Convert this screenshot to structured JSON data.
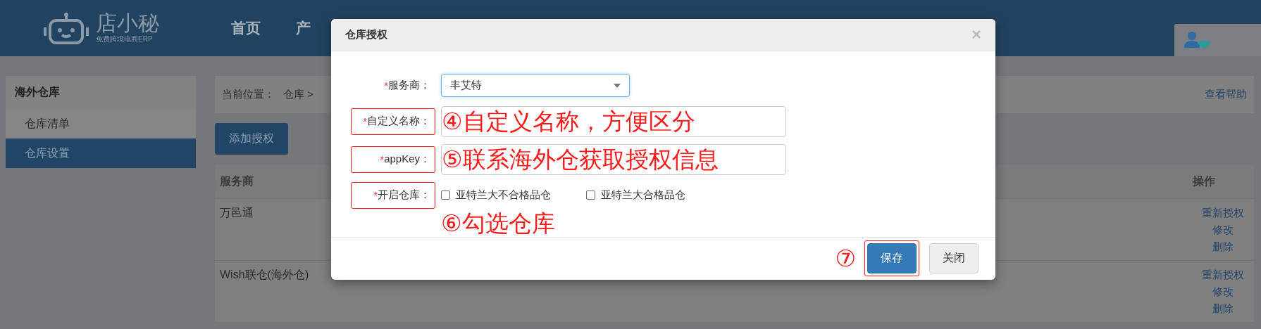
{
  "header": {
    "logo": {
      "name": "店小秘",
      "tagline": "免费跨境电商ERP"
    },
    "nav": [
      {
        "label": "首页"
      },
      {
        "label": "产"
      }
    ]
  },
  "sidebar": {
    "title": "海外仓库",
    "items": [
      {
        "label": "仓库清单",
        "selected": false
      },
      {
        "label": "仓库设置",
        "selected": true
      }
    ]
  },
  "breadcrumb": {
    "label": "当前位置：",
    "path": "仓库 >"
  },
  "help_link": "查看帮助",
  "add_button": "添加授权",
  "table": {
    "columns": [
      "服务商",
      "操作"
    ],
    "rows": [
      {
        "provider": "万邑通",
        "actions": [
          "重新授权",
          "修改",
          "删除"
        ]
      },
      {
        "provider": "Wish联仓(海外仓)",
        "actions": [
          "重新授权",
          "修改",
          "删除"
        ]
      }
    ]
  },
  "dialog": {
    "title": "仓库授权",
    "close": "×",
    "fields": [
      {
        "kind": "select",
        "mark": "*",
        "label": "服务商：",
        "value": "丰艾特",
        "highlighted": false
      },
      {
        "kind": "input",
        "mark": "*",
        "label": "自定义名称：",
        "highlighted": true,
        "annotation": "④自定义名称，方便区分"
      },
      {
        "kind": "input",
        "mark": "*",
        "label": "appKey：",
        "highlighted": true,
        "annotation": "⑤联系海外仓获取授权信息"
      },
      {
        "kind": "checkboxes",
        "mark": "*",
        "label": "开启仓库：",
        "highlighted": true,
        "annotation": "⑥勾选仓库",
        "options": [
          {
            "label": "亚特兰大不合格品仓",
            "checked": false
          },
          {
            "label": "亚特兰大合格品仓",
            "checked": false
          }
        ]
      }
    ],
    "buttons": [
      {
        "label": "保存",
        "kind": "primary",
        "highlighted": true,
        "annotation": "⑦"
      },
      {
        "label": "关闭",
        "kind": "default",
        "highlighted": false
      }
    ]
  }
}
